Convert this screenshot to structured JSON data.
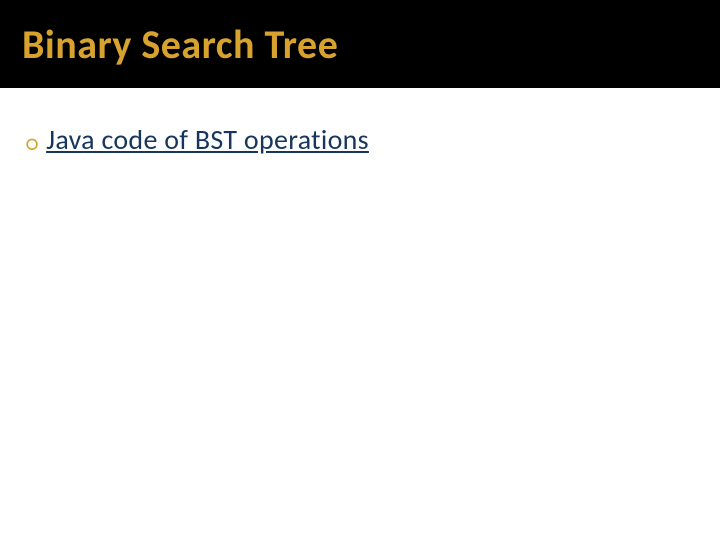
{
  "slide": {
    "title": "Binary Search Tree",
    "bullets": [
      {
        "icon": "○",
        "text": "Java code of BST operations"
      }
    ]
  },
  "colors": {
    "accent": "#d7a22e",
    "link": "#17365d",
    "band_bg": "#000000",
    "page_bg": "#ffffff"
  }
}
